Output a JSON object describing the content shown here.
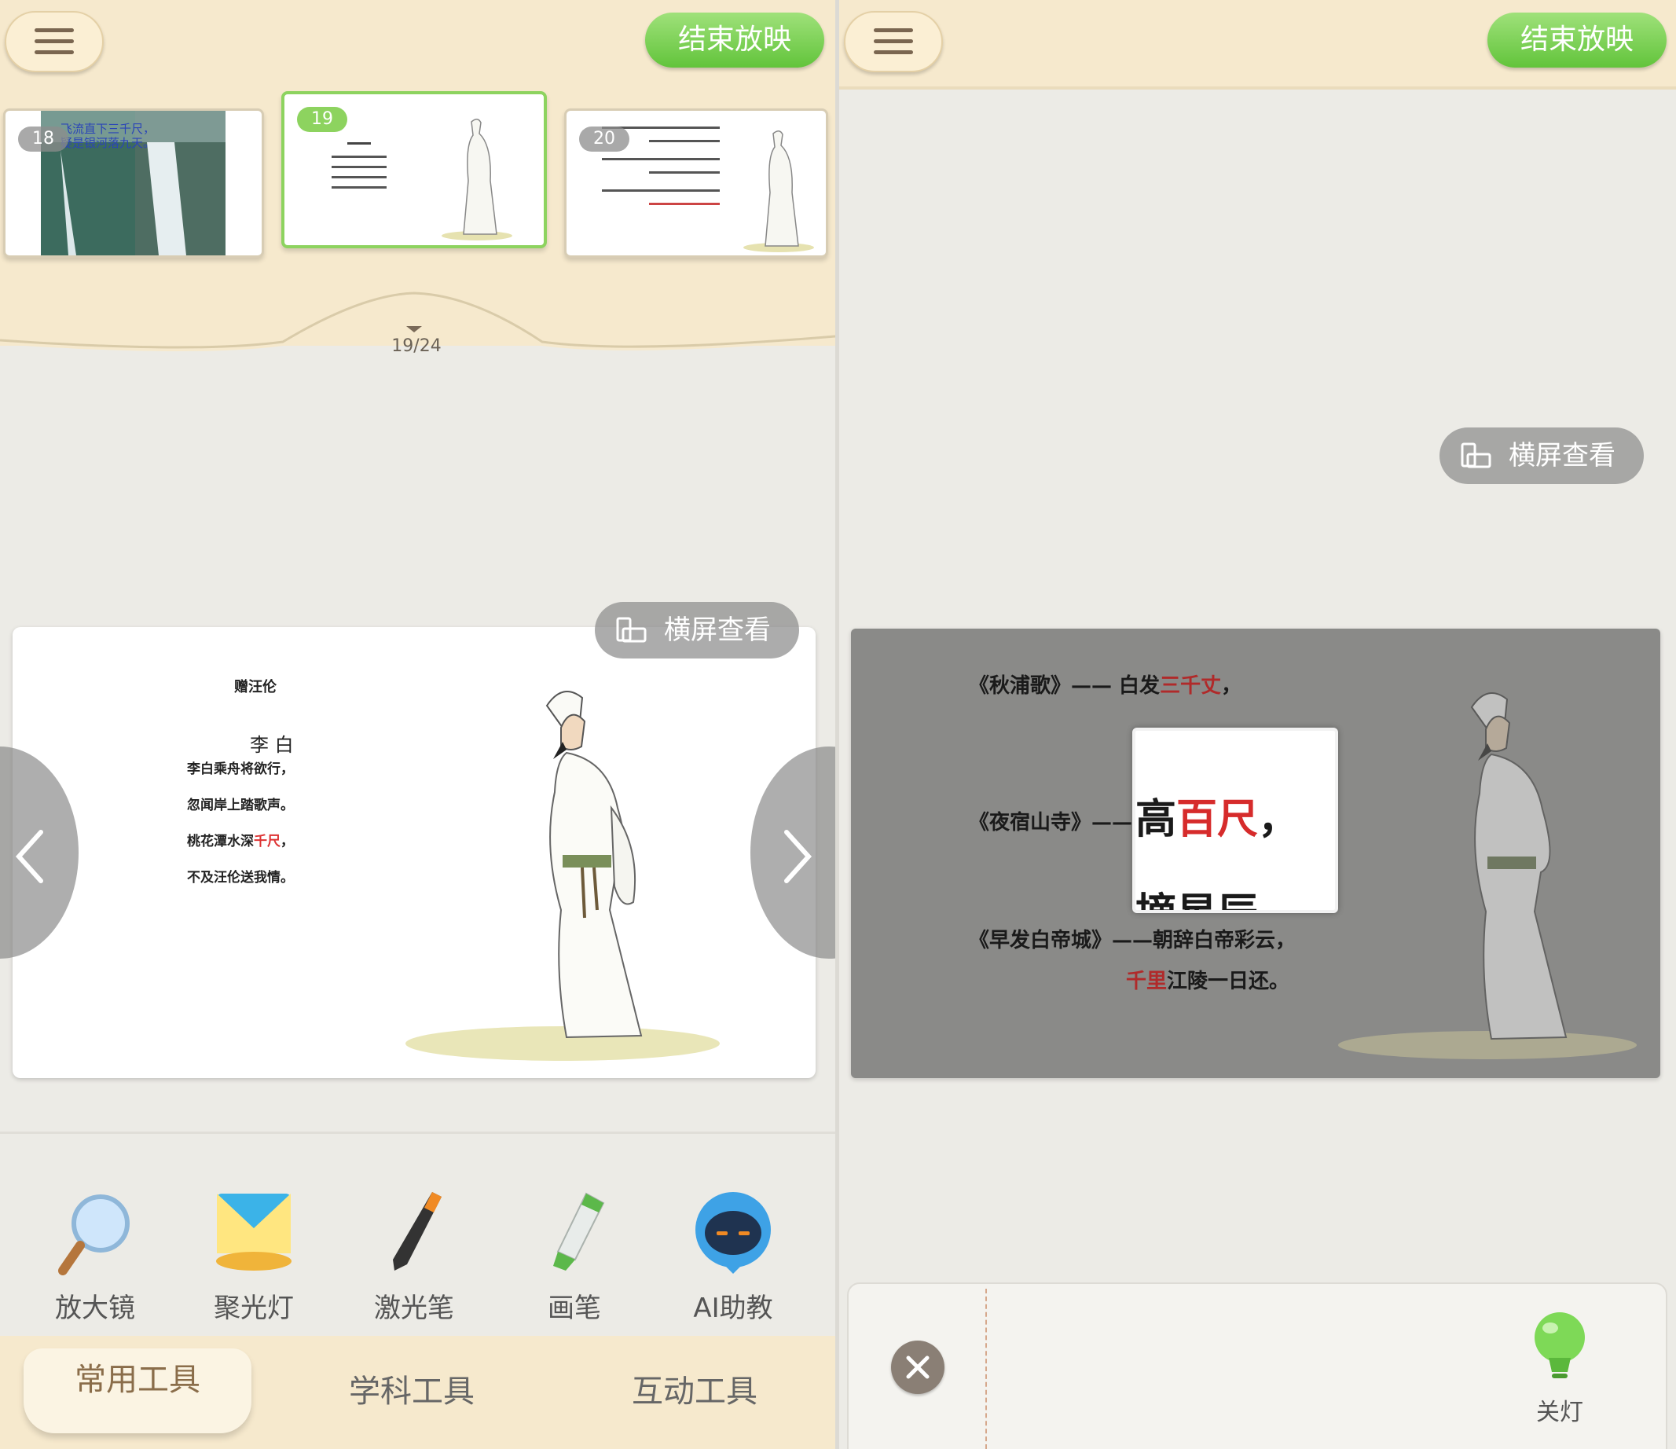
{
  "left": {
    "header": {
      "end_button": "结束放映"
    },
    "thumbnails": [
      {
        "number": "18",
        "caption_line1": "飞流直下三千尺，",
        "caption_line2": "疑是银河落九天。"
      },
      {
        "number": "19"
      },
      {
        "number": "20"
      }
    ],
    "counter": "19/24",
    "landscape_button": "横屏查看",
    "slide": {
      "title": "赠汪伦",
      "author": "李 白",
      "lines": [
        "李白乘舟将欲行，",
        "忽闻岸上踏歌声。"
      ],
      "line3_a": "桃花潭水深",
      "line3_red": "千尺",
      "line3_b": "，",
      "line4": "不及汪伦送我情。"
    },
    "tools": [
      {
        "label": "放大镜",
        "icon": "magnifier-icon"
      },
      {
        "label": "聚光灯",
        "icon": "spotlight-icon"
      },
      {
        "label": "激光笔",
        "icon": "laser-pen-icon"
      },
      {
        "label": "画笔",
        "icon": "marker-pen-icon"
      },
      {
        "label": "AI助教",
        "icon": "ai-assistant-robot-icon"
      }
    ],
    "tabs": [
      "常用工具",
      "学科工具",
      "互动工具"
    ]
  },
  "right": {
    "header": {
      "end_button": "结束放映"
    },
    "landscape_button": "横屏查看",
    "slide": {
      "row1_a": "《秋浦歌》—— 白发",
      "row1_red": "三千丈",
      "row1_b": "，",
      "row2_a": "《夜宿山寺》——",
      "row3_a": "《早发白帝城》——朝辞白帝彩云，",
      "row4_red": "千里",
      "row4_b": "江陵一日还。",
      "spotlight_line1_a": "高",
      "spotlight_line1_red": "百尺",
      "spotlight_line1_b": "，",
      "spotlight_line2": "摘星辰"
    },
    "tray": {
      "light_label": "关灯",
      "light_icon": "lightbulb-icon",
      "close_icon": "close-icon"
    }
  },
  "colors": {
    "accent_green": "#8dd35f",
    "header_cream": "#f6e9cd",
    "highlight_red": "#d33333"
  }
}
